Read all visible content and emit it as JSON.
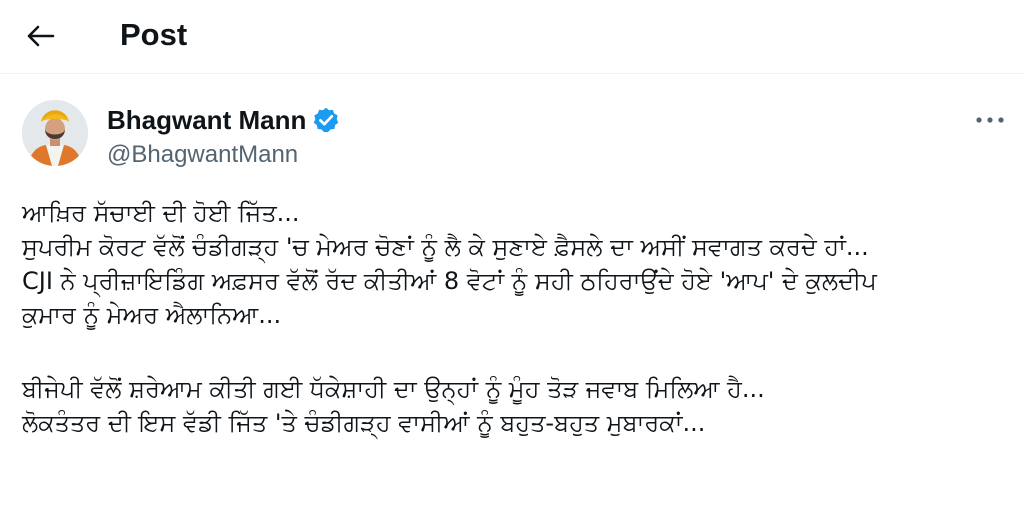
{
  "header": {
    "title": "Post",
    "back_icon": "arrow-left-icon"
  },
  "post": {
    "author": {
      "name": "Bhagwant Mann",
      "handle": "@BhagwantMann",
      "verified": true,
      "verified_color": "#1d9bf0",
      "avatar_icon": "avatar-photo"
    },
    "more_icon": "ellipsis-icon",
    "text_lines": [
      "ਆਖ਼ਿਰ ਸੱਚਾਈ ਦੀ ਹੋਈ ਜਿੱਤ...",
      "ਸੁਪਰੀਮ ਕੋਰਟ ਵੱਲੋਂ ਚੰਡੀਗੜ੍ਹ 'ਚ ਮੇਅਰ ਚੋਣਾਂ ਨੂੰ ਲੈ ਕੇ ਸੁਣਾਏ ਫ਼ੈਸਲੇ ਦਾ ਅਸੀਂ ਸਵਾਗਤ ਕਰਦੇ ਹਾਂ...",
      "CJI ਨੇ ਪ੍ਰੀਜ਼ਾਇਡਿੰਗ ਅਫ਼ਸਰ ਵੱਲੋਂ ਰੱਦ ਕੀਤੀਆਂ 8 ਵੋਟਾਂ ਨੂੰ ਸਹੀ ਠਹਿਰਾਉਂਦੇ ਹੋਏ 'ਆਪ' ਦੇ ਕੁਲਦੀਪ",
      "ਕੁਮਾਰ ਨੂੰ ਮੇਅਰ ਐਲਾਨਿਆ...",
      "ਬੀਜੇਪੀ ਵੱਲੋਂ ਸ਼ਰੇਆਮ ਕੀਤੀ ਗਈ ਧੱਕੇਸ਼ਾਹੀ ਦਾ ਉਨ੍ਹਾਂ ਨੂੰ ਮੂੰਹ ਤੋੜ ਜਵਾਬ ਮਿਲਿਆ ਹੈ...",
      "ਲੋਕਤੰਤਰ ਦੀ ਇਸ ਵੱਡੀ ਜਿੱਤ 'ਤੇ ਚੰਡੀਗੜ੍ਹ ਵਾਸੀਆਂ ਨੂੰ ਬਹੁਤ-ਬਹੁਤ ਮੁਬਾਰਕਾਂ..."
    ]
  }
}
